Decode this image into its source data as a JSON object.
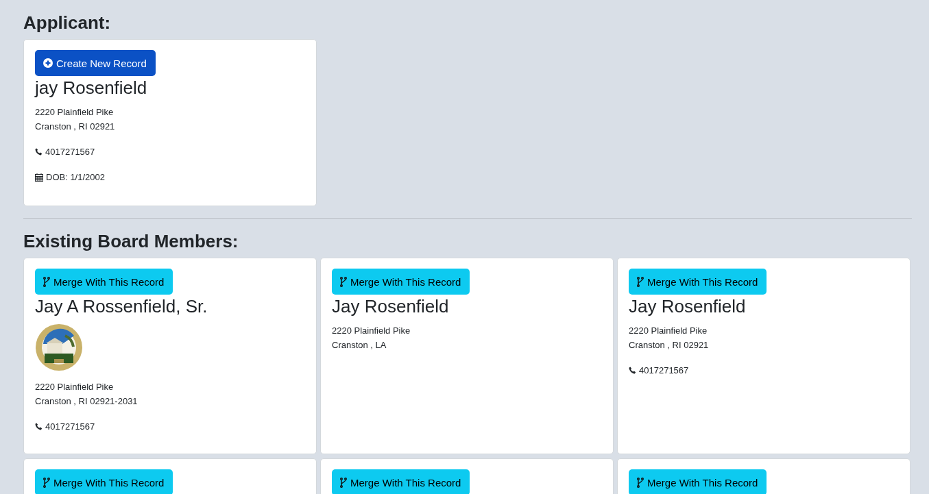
{
  "applicant": {
    "heading": "Applicant:",
    "card": {
      "button": {
        "kind": "create",
        "label": "Create New Record"
      },
      "name": "jay Rosenfield",
      "address_lines": [
        "2220 Plainfield Pike",
        "Cranston , RI 02921"
      ],
      "phone": "4017271567",
      "dob": "DOB: 1/1/2002"
    }
  },
  "board_members": {
    "heading": "Existing Board Members:",
    "cards": [
      {
        "button": {
          "kind": "merge",
          "label": "Merge With This Record"
        },
        "name": "Jay A Rossenfield, Sr.",
        "address_lines": [
          "2220 Plainfield Pike",
          "Cranston , RI 02921-2031"
        ],
        "phone": "4017271567"
      },
      {
        "button": {
          "kind": "merge",
          "label": "Merge With This Record"
        },
        "name": "Jay Rosenfield",
        "address_lines": [
          "2220 Plainfield Pike",
          "Cranston , LA"
        ]
      },
      {
        "button": {
          "kind": "merge",
          "label": "Merge With This Record"
        },
        "name": "Jay Rosenfield",
        "address_lines": [
          "2220 Plainfield Pike",
          "Cranston , RI 02921"
        ],
        "phone": "4017271567"
      },
      {
        "button": {
          "kind": "merge",
          "label": "Merge With This Record"
        }
      },
      {
        "button": {
          "kind": "merge",
          "label": "Merge With This Record"
        }
      },
      {
        "button": {
          "kind": "merge",
          "label": "Merge With This Record"
        }
      }
    ]
  }
}
